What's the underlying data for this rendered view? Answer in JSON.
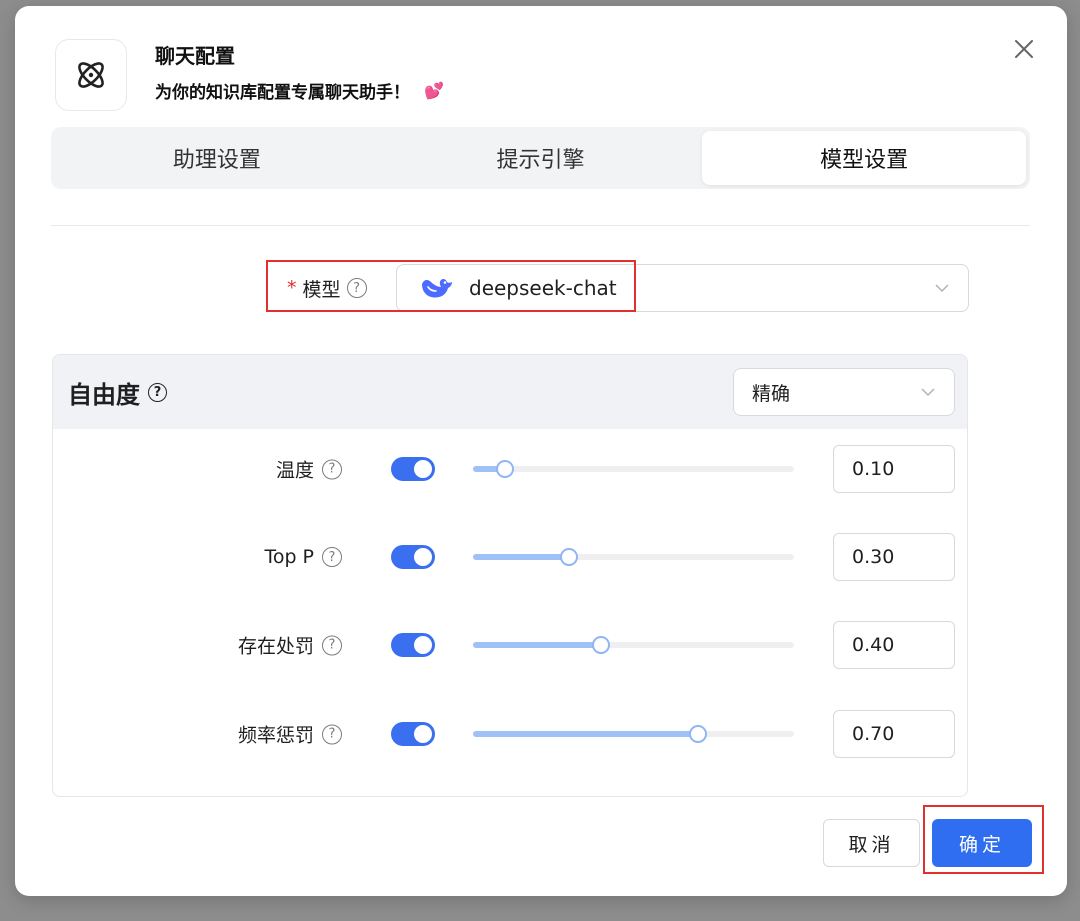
{
  "dialog": {
    "title": "聊天配置",
    "subtitle": "为你的知识库配置专属聊天助手！",
    "subtitle_emoji": "💕",
    "close_icon": "close-icon",
    "app_icon": "atom-icon"
  },
  "tabs": [
    {
      "label": "助理设置",
      "active": false
    },
    {
      "label": "提示引擎",
      "active": false
    },
    {
      "label": "模型设置",
      "active": true
    }
  ],
  "model": {
    "required_mark": "*",
    "label": "模型",
    "value": "deepseek-chat",
    "icon": "deepseek-whale-icon"
  },
  "freedom": {
    "title": "自由度",
    "preset": "精确"
  },
  "params": [
    {
      "label": "温度",
      "enabled": true,
      "value": "0.10",
      "level": 0.1
    },
    {
      "label": "Top P",
      "enabled": true,
      "value": "0.30",
      "level": 0.3
    },
    {
      "label": "存在处罚",
      "enabled": true,
      "value": "0.40",
      "level": 0.4
    },
    {
      "label": "频率惩罚",
      "enabled": true,
      "value": "0.70",
      "level": 0.7
    }
  ],
  "footer": {
    "cancel_label": "取消",
    "ok_label": "确定"
  },
  "colors": {
    "accent": "#2f6ef0",
    "highlight_box": "#e0312f",
    "slider_fill": "#9fc1f7"
  }
}
